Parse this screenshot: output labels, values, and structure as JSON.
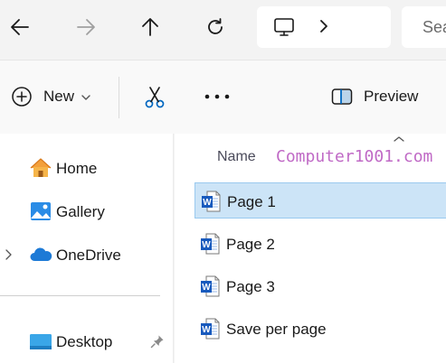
{
  "nav": {
    "back_icon": "arrow-left-icon",
    "forward_icon": "arrow-right-icon",
    "up_icon": "arrow-up-icon",
    "refresh_icon": "refresh-icon",
    "address_icon": "this-pc-icon",
    "search_placeholder": "Sea"
  },
  "commandbar": {
    "new_label": "New",
    "preview_label": "Preview"
  },
  "navpane": {
    "items": [
      {
        "label": "Home",
        "icon": "home-icon"
      },
      {
        "label": "Gallery",
        "icon": "gallery-icon"
      },
      {
        "label": "OneDrive",
        "icon": "onedrive-icon"
      },
      {
        "label": "Desktop",
        "icon": "desktop-icon"
      }
    ]
  },
  "content": {
    "column_name": "Name",
    "watermark": "Computer1001.com",
    "files": [
      {
        "name": "Page 1",
        "icon": "word-document-icon",
        "selected": true
      },
      {
        "name": "Page 2",
        "icon": "word-document-icon",
        "selected": false
      },
      {
        "name": "Page 3",
        "icon": "word-document-icon",
        "selected": false
      },
      {
        "name": "Save per page",
        "icon": "word-document-icon",
        "selected": false
      }
    ]
  },
  "colors": {
    "selection": "#cce4f7",
    "accent": "#0067c0",
    "watermark": "#c06ac6"
  }
}
